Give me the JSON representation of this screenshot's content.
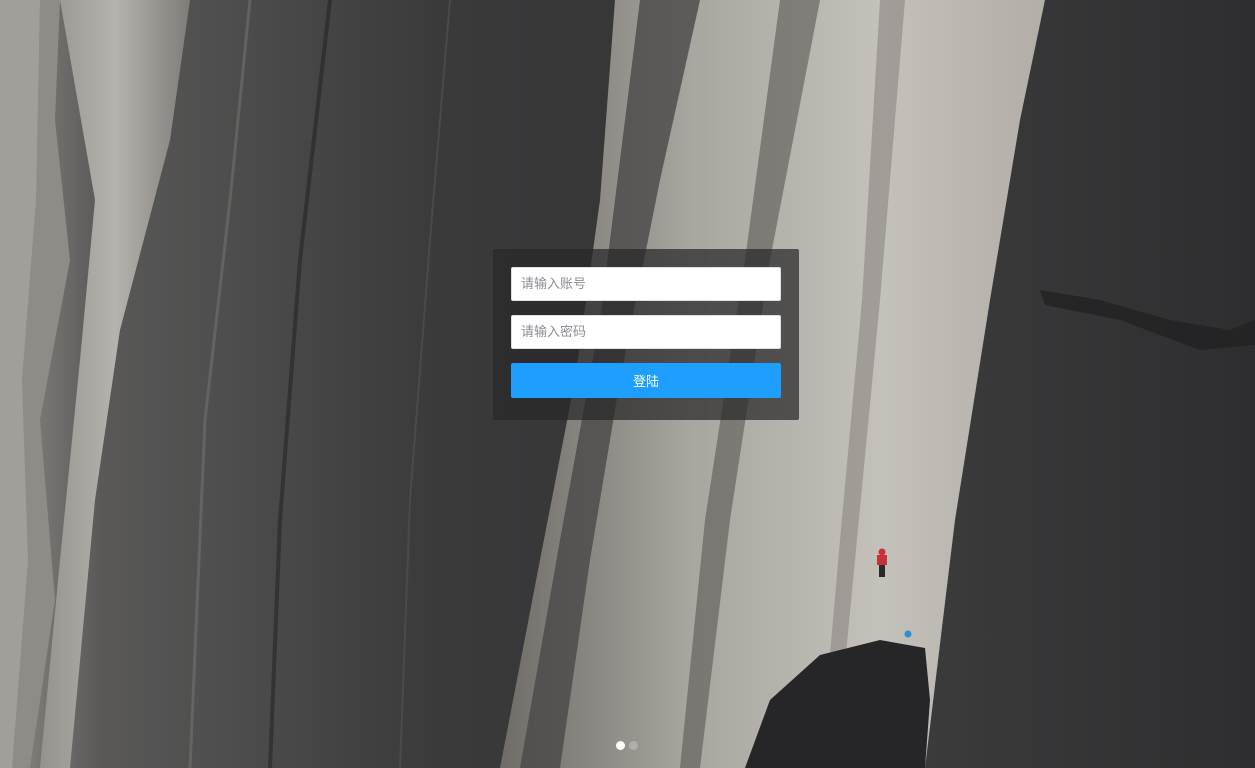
{
  "background": {
    "scene": "granite-cliff-with-climbers",
    "colors": {
      "dark_rock": "#2f2f31",
      "light_rock": "#b8b4ad",
      "shadow": "#1c1c1e",
      "climber_red": "#c8313a",
      "climber_blue": "#2a8fd6"
    }
  },
  "login": {
    "account_placeholder": "请输入账号",
    "password_placeholder": "请输入密码",
    "account_value": "",
    "password_value": "",
    "submit_label": "登陆"
  },
  "carousel": {
    "active_index": 0,
    "count": 2
  },
  "theme": {
    "accent": "#1e9fff",
    "panel_bg": "rgba(40,40,40,0.72)"
  }
}
